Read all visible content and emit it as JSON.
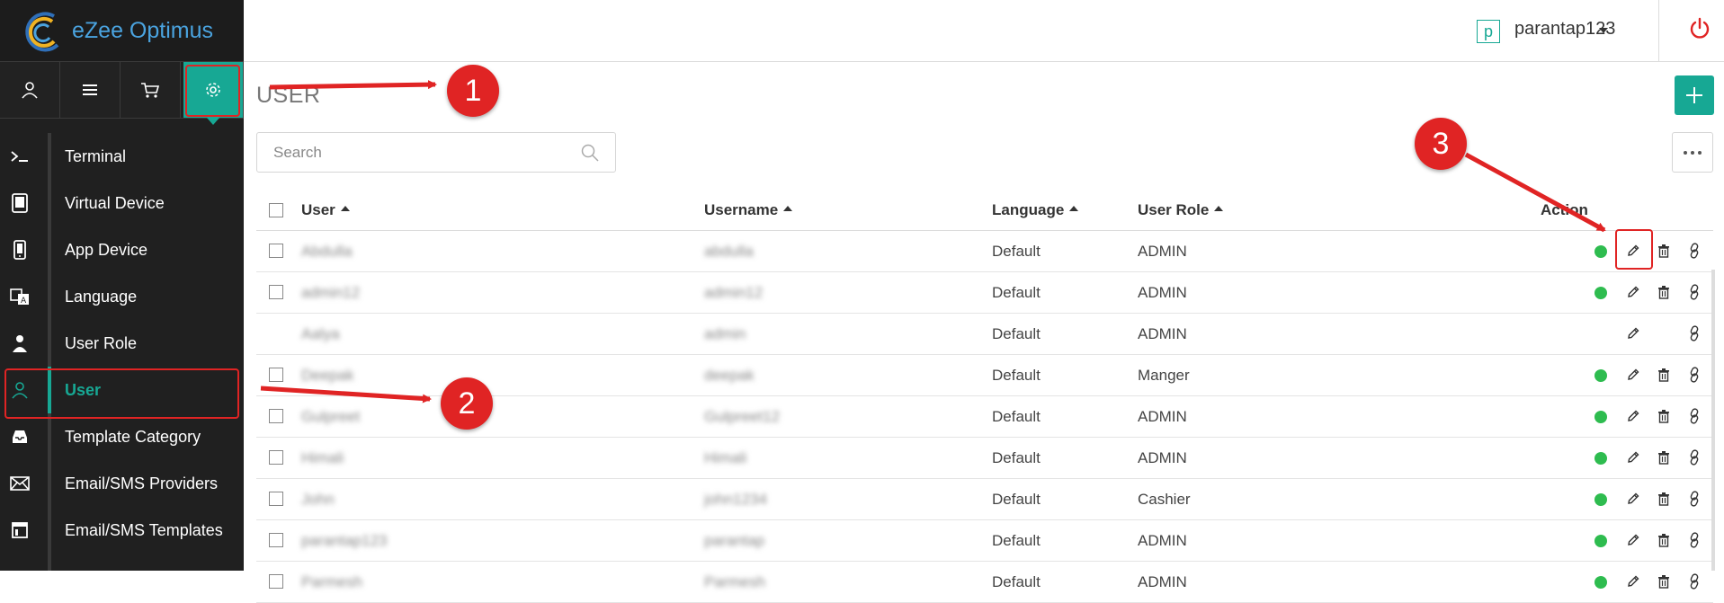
{
  "app": {
    "name": "eZee Optimus"
  },
  "topbar": {
    "user_initial": "p",
    "username": "parantap123"
  },
  "iconbar": [
    "user-icon",
    "list-icon",
    "cart-icon",
    "gear-icon"
  ],
  "sidebar": {
    "items": [
      {
        "label": "Terminal",
        "icon": "terminal-icon"
      },
      {
        "label": "Virtual Device",
        "icon": "tablet-icon"
      },
      {
        "label": "App Device",
        "icon": "phone-icon"
      },
      {
        "label": "Language",
        "icon": "language-icon"
      },
      {
        "label": "User Role",
        "icon": "person-icon"
      },
      {
        "label": "User",
        "icon": "user-icon",
        "active": true
      },
      {
        "label": "Template Category",
        "icon": "inbox-icon"
      },
      {
        "label": "Email/SMS Providers",
        "icon": "envelope-icon"
      },
      {
        "label": "Email/SMS Templates",
        "icon": "template-icon"
      }
    ]
  },
  "page": {
    "title": "USER",
    "search_placeholder": "Search"
  },
  "table": {
    "columns": {
      "user": "User",
      "username": "Username",
      "language": "Language",
      "role": "User Role",
      "action": "Action"
    },
    "rows": [
      {
        "user": "Abdulla",
        "username": "abdulla",
        "language": "Default",
        "role": "ADMIN",
        "checkbox": true,
        "active": true,
        "delete": true
      },
      {
        "user": "admin12",
        "username": "admin12",
        "language": "Default",
        "role": "ADMIN",
        "checkbox": true,
        "active": true,
        "delete": true
      },
      {
        "user": "Aalya",
        "username": "admin",
        "language": "Default",
        "role": "ADMIN",
        "checkbox": false,
        "active": false,
        "delete": false
      },
      {
        "user": "Deepak",
        "username": "deepak",
        "language": "Default",
        "role": "Manger",
        "checkbox": true,
        "active": true,
        "delete": true
      },
      {
        "user": "Gulpreet",
        "username": "Gulpreet12",
        "language": "Default",
        "role": "ADMIN",
        "checkbox": true,
        "active": true,
        "delete": true
      },
      {
        "user": "Himali",
        "username": "Himali",
        "language": "Default",
        "role": "ADMIN",
        "checkbox": true,
        "active": true,
        "delete": true
      },
      {
        "user": "John",
        "username": "john1234",
        "language": "Default",
        "role": "Cashier",
        "checkbox": true,
        "active": true,
        "delete": true
      },
      {
        "user": "parantap123",
        "username": "parantap",
        "language": "Default",
        "role": "ADMIN",
        "checkbox": true,
        "active": true,
        "delete": true
      },
      {
        "user": "Parmesh",
        "username": "Parmesh",
        "language": "Default",
        "role": "ADMIN",
        "checkbox": true,
        "active": true,
        "delete": true
      }
    ]
  },
  "annotations": {
    "step1": "1",
    "step2": "2",
    "step3": "3"
  },
  "colors": {
    "accent": "#17a894",
    "sidebar": "#202020",
    "annotation": "#e02424",
    "active_dot": "#2ebc4f"
  }
}
